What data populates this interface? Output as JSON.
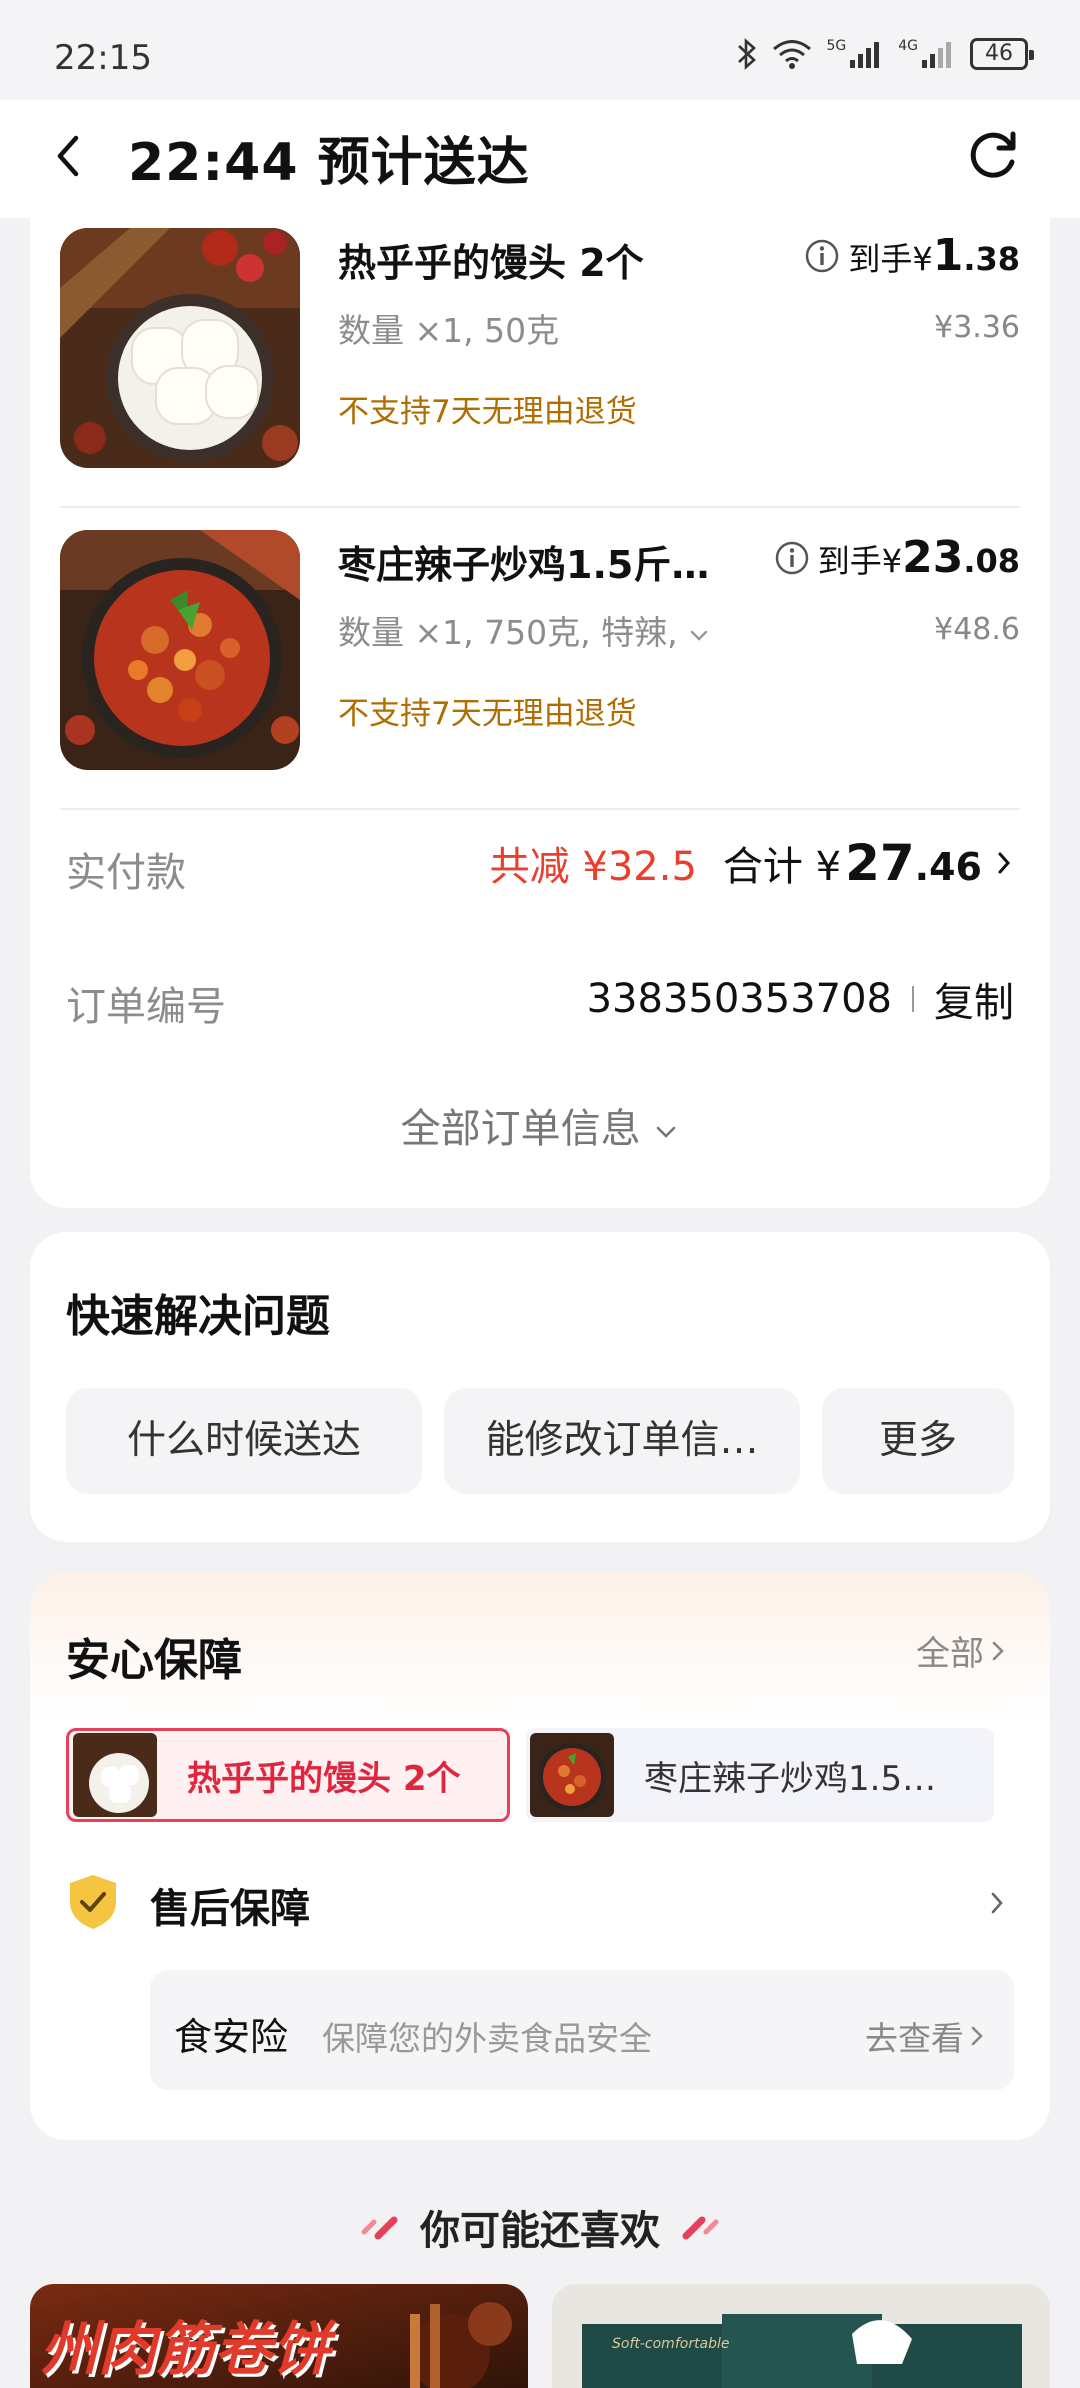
{
  "status_bar": {
    "time": "22:15",
    "net_5g": "5G",
    "net_4g": "4G",
    "battery": "46"
  },
  "nav": {
    "title": "22:44 预计送达"
  },
  "order": {
    "items": [
      {
        "name": "热乎乎的馒头  2个",
        "spec": "数量 ×1, 50克",
        "note": "不支持7天无理由退货",
        "price_prefix": "到手¥",
        "price_int": "1",
        "price_dec": ".38",
        "original_price": "¥3.36"
      },
      {
        "name": "枣庄辣子炒鸡1.5斤…",
        "spec": "数量 ×1, 750克, 特辣, ",
        "note": "不支持7天无理由退货",
        "price_prefix": "到手¥",
        "price_int": "23",
        "price_dec": ".08",
        "original_price": "¥48.6"
      }
    ],
    "paid_label": "实付款",
    "saved": "共减 ¥32.5",
    "total_label": "合计 ¥",
    "total_int": "27",
    "total_dec": ".46",
    "order_no_label": "订单编号",
    "order_no": "338350353708",
    "copy_label": "复制",
    "all_info_label": "全部订单信息"
  },
  "quick_solve": {
    "title": "快速解决问题",
    "chips": [
      "什么时候送达",
      "能修改订单信…",
      "更多"
    ]
  },
  "guarantee": {
    "title": "安心保障",
    "all_label": "全部",
    "tabs": [
      "热乎乎的馒头  2个",
      "枣庄辣子炒鸡1.5…"
    ],
    "after_sale_title": "售后保障",
    "insurance_name": "食安险",
    "insurance_desc": "保障您的外卖食品安全",
    "insurance_link": "去查看"
  },
  "recommend": {
    "title": "你可能还喜欢",
    "left_banner_text": "州肉筋卷饼",
    "right_banner_text": "Soft-comfortable"
  },
  "colors": {
    "accent_red": "#e8402f",
    "tab_red": "#e9405a",
    "note_brown": "#b06d00",
    "shield_yellow": "#f5c542"
  }
}
